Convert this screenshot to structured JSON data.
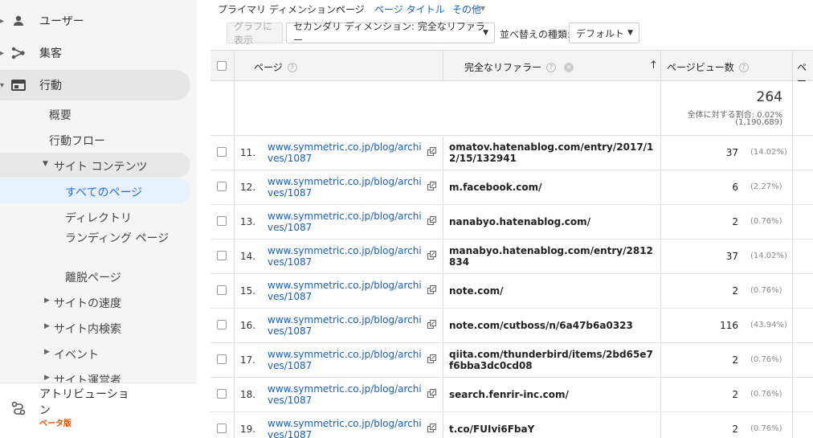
{
  "sidebar": {
    "items": [
      {
        "label": "ユーザー",
        "icon": "person-icon"
      },
      {
        "label": "集客",
        "icon": "acquisition-icon"
      },
      {
        "label": "行動",
        "icon": "behavior-icon"
      }
    ],
    "sub_items": [
      "概要",
      "行動フロー",
      "サイト コンテンツ",
      "すべてのページ",
      "ディレクトリ",
      "ランディング ページ",
      "離脱ページ",
      "サイトの速度",
      "サイト内検索",
      "イベント",
      "サイト運営者"
    ],
    "attribution": {
      "label": "アトリビューション",
      "badge": "ベータ版"
    }
  },
  "topbar": {
    "primary_label": "プライマリ ディメンション:",
    "active": "ページ",
    "page_title": "ページ タイトル",
    "other": "その他"
  },
  "toolbar": {
    "graph_button": "グラフに表示",
    "secondary_dimension": "セカンダリ ディメンション: 完全なリファラー",
    "sort_label": "並べ替えの種類:",
    "sort_value": "デフォルト"
  },
  "table": {
    "headers": {
      "page": "ページ",
      "referrer": "完全なリファラー",
      "pageviews": "ページビュー数",
      "next": "ペー"
    },
    "totals": {
      "value": "264",
      "share_label": "全体に対する割合: 0.02%",
      "total": "(1,190,689)"
    },
    "rows": [
      {
        "num": "11.",
        "page": "www.symmetric.co.jp/blog/archives/1087",
        "ref": "omatov.hatenablog.com/entry/2017/12/15/132941",
        "pv": "37",
        "pct": "(14.02%)"
      },
      {
        "num": "12.",
        "page": "www.symmetric.co.jp/blog/archives/1087",
        "ref": "m.facebook.com/",
        "pv": "6",
        "pct": "(2.27%)"
      },
      {
        "num": "13.",
        "page": "www.symmetric.co.jp/blog/archives/1087",
        "ref": "nanabyo.hatenablog.com/",
        "pv": "2",
        "pct": "(0.76%)"
      },
      {
        "num": "14.",
        "page": "www.symmetric.co.jp/blog/archives/1087",
        "ref": "manabyo.hatenablog.com/entry/2812834",
        "pv": "37",
        "pct": "(14.02%)"
      },
      {
        "num": "15.",
        "page": "www.symmetric.co.jp/blog/archives/1087",
        "ref": "note.com/",
        "pv": "2",
        "pct": "(0.76%)"
      },
      {
        "num": "16.",
        "page": "www.symmetric.co.jp/blog/archives/1087",
        "ref": "note.com/cutboss/n/6a47b6a0323",
        "pv": "116",
        "pct": "(43.94%)"
      },
      {
        "num": "17.",
        "page": "www.symmetric.co.jp/blog/archives/1087",
        "ref": "qiita.com/thunderbird/items/2bd65e7f6bba3dc0cd08",
        "pv": "2",
        "pct": "(0.76%)"
      },
      {
        "num": "18.",
        "page": "www.symmetric.co.jp/blog/archives/1087",
        "ref": "search.fenrir-inc.com/",
        "pv": "2",
        "pct": "(0.76%)"
      },
      {
        "num": "19.",
        "page": "www.symmetric.co.jp/blog/archives/1087",
        "ref": "t.co/FUIvi6FbaY",
        "pv": "2",
        "pct": "(0.76%)"
      }
    ]
  },
  "colors": {
    "link": "#1a5eb8",
    "accent": "#1a73e8",
    "badge": "#e65100",
    "sidebar_bg": "#f5f5f5",
    "active_sub_bg": "#e8f0fe"
  }
}
